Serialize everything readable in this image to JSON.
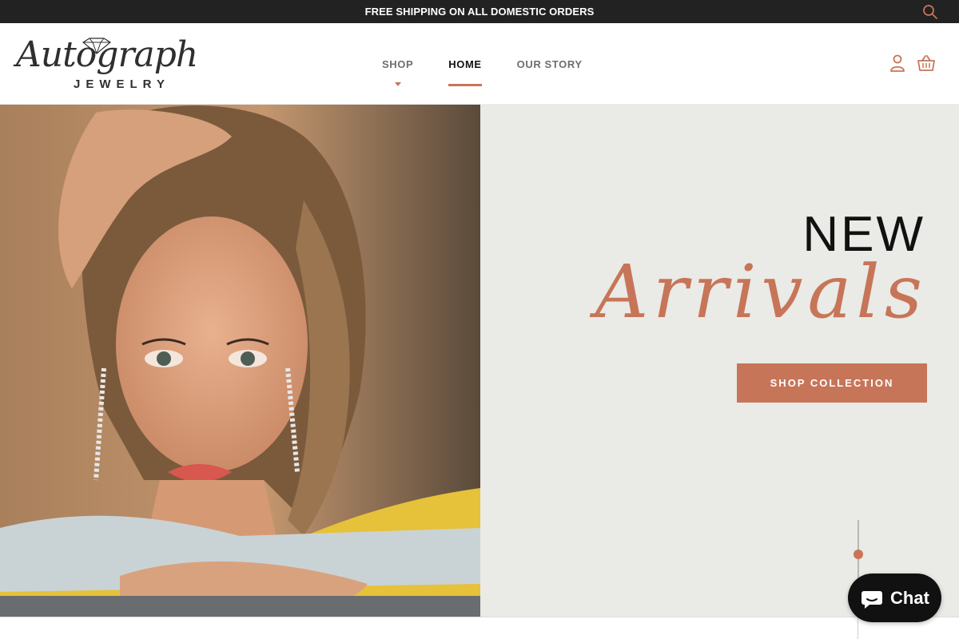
{
  "announcement": {
    "text": "FREE SHIPPING ON ALL DOMESTIC ORDERS"
  },
  "brand": {
    "script_name": "Autograph",
    "sub_name": "JEWELRY"
  },
  "nav": {
    "items": [
      {
        "label": "SHOP",
        "has_dropdown": true,
        "active": false
      },
      {
        "label": "HOME",
        "has_dropdown": false,
        "active": true
      },
      {
        "label": "OUR STORY",
        "has_dropdown": false,
        "active": false
      }
    ]
  },
  "icons": {
    "search": "search-icon",
    "account": "user-icon",
    "cart": "basket-icon",
    "chat": "chat-bubble-icon"
  },
  "hero": {
    "headline_new": "NEW",
    "headline_script": "Arrivals",
    "cta_label": "SHOP COLLECTION",
    "slides": {
      "count": 1,
      "active": 1
    }
  },
  "chat": {
    "label": "Chat"
  },
  "colors": {
    "accent": "#c77558",
    "announcement_bg": "#222222",
    "hero_right_bg": "#eaeae6",
    "chat_bg": "#111111"
  }
}
